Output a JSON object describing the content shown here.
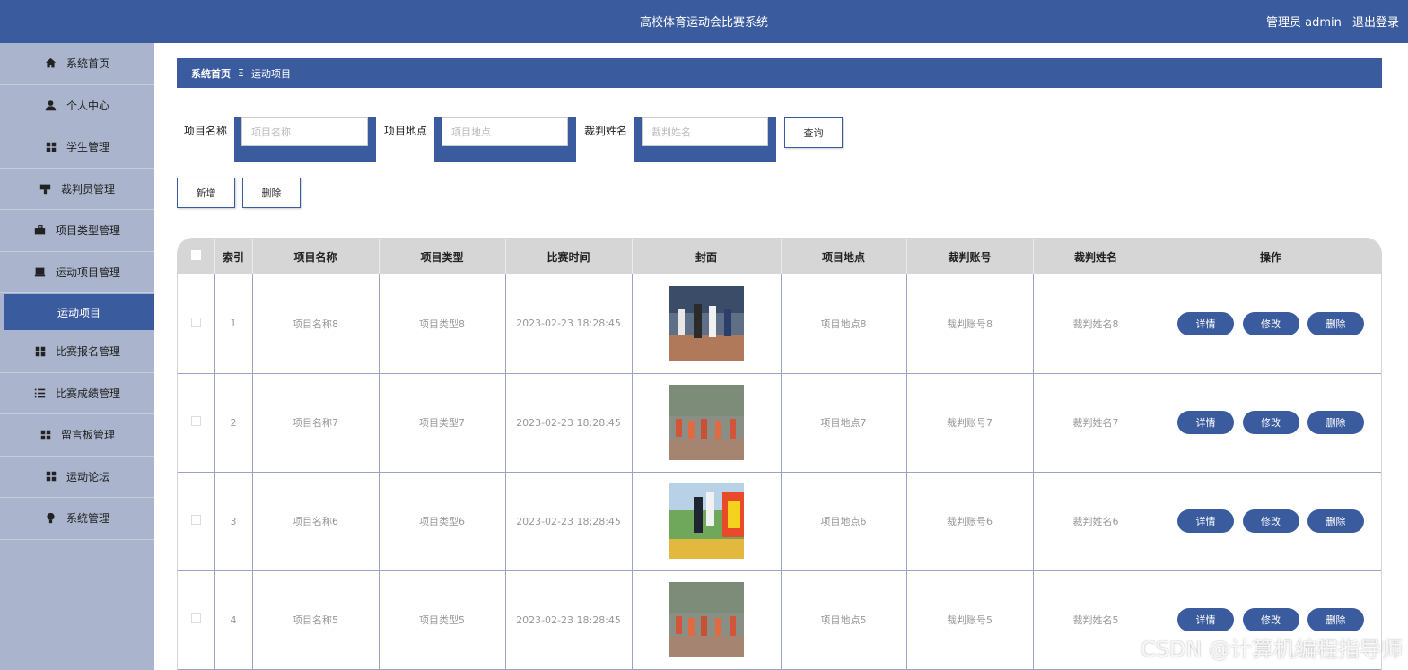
{
  "header": {
    "title": "高校体育运动会比赛系统",
    "user_label": "管理员 admin",
    "logout_label": "退出登录"
  },
  "sidebar": {
    "items": [
      {
        "label": "系统首页",
        "icon": "home-icon"
      },
      {
        "label": "个人中心",
        "icon": "user-icon"
      },
      {
        "label": "学生管理",
        "icon": "grid-icon"
      },
      {
        "label": "裁判员管理",
        "icon": "sign-icon"
      },
      {
        "label": "项目类型管理",
        "icon": "briefcase-icon"
      },
      {
        "label": "运动项目管理",
        "icon": "box-icon"
      },
      {
        "label": "比赛报名管理",
        "icon": "grid-icon"
      },
      {
        "label": "比赛成绩管理",
        "icon": "list-icon"
      },
      {
        "label": "留言板管理",
        "icon": "grid-icon"
      },
      {
        "label": "运动论坛",
        "icon": "grid-icon"
      },
      {
        "label": "系统管理",
        "icon": "bulb-icon"
      }
    ],
    "active_sub": "运动项目"
  },
  "breadcrumb": {
    "home": "系统首页",
    "separator": "Ξ",
    "current": "运动项目"
  },
  "search": {
    "name_label": "项目名称",
    "name_placeholder": "项目名称",
    "location_label": "项目地点",
    "location_placeholder": "项目地点",
    "judge_label": "裁判姓名",
    "judge_placeholder": "裁判姓名",
    "query_label": "查询"
  },
  "actions": {
    "add_label": "新增",
    "delete_label": "删除"
  },
  "table": {
    "columns": [
      "索引",
      "项目名称",
      "项目类型",
      "比赛时间",
      "封面",
      "项目地点",
      "裁判账号",
      "裁判姓名",
      "操作"
    ],
    "rows": [
      {
        "index": "1",
        "name": "项目名称8",
        "type": "项目类型8",
        "time": "2023-02-23 18:28:45",
        "location": "项目地点8",
        "judge_account": "裁判账号8",
        "judge_name": "裁判姓名8"
      },
      {
        "index": "2",
        "name": "项目名称7",
        "type": "项目类型7",
        "time": "2023-02-23 18:28:45",
        "location": "项目地点7",
        "judge_account": "裁判账号7",
        "judge_name": "裁判姓名7"
      },
      {
        "index": "3",
        "name": "项目名称6",
        "type": "项目类型6",
        "time": "2023-02-23 18:28:45",
        "location": "项目地点6",
        "judge_account": "裁判账号6",
        "judge_name": "裁判姓名6"
      },
      {
        "index": "4",
        "name": "项目名称5",
        "type": "项目类型5",
        "time": "2023-02-23 18:28:45",
        "location": "项目地点5",
        "judge_account": "裁判账号5",
        "judge_name": "裁判姓名5"
      }
    ],
    "op_detail": "详情",
    "op_edit": "修改",
    "op_delete": "删除"
  },
  "watermark": "CSDN @计算机编程指导师",
  "colors": {
    "primary": "#3a5b9e",
    "sidebar_bg": "#aab4cd"
  }
}
